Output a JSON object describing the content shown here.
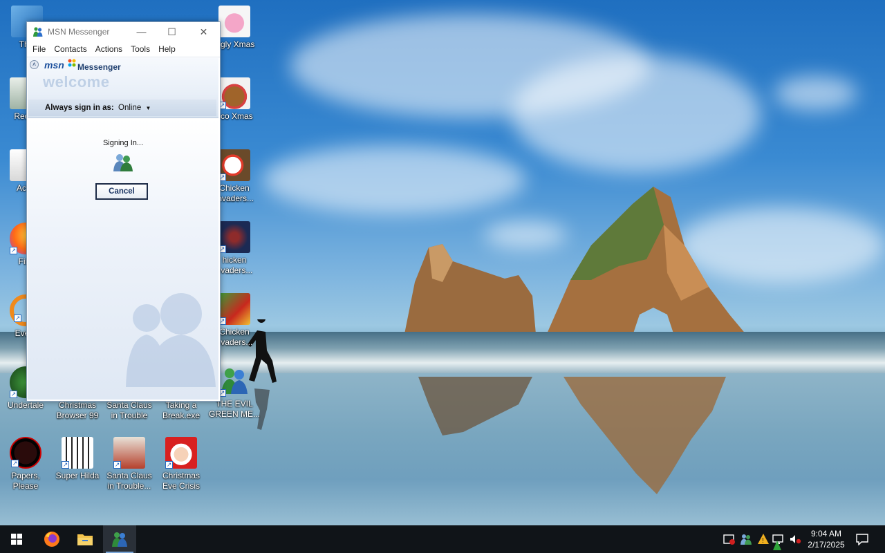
{
  "window": {
    "title": "MSN Messenger",
    "menu": [
      "File",
      "Contacts",
      "Actions",
      "Tools",
      "Help"
    ],
    "brand_logo": "msn",
    "brand_word": "Messenger",
    "welcome": "welcome",
    "status_label": "Always sign in as:",
    "status_value": "Online",
    "signing_text": "Signing In...",
    "cancel_label": "Cancel"
  },
  "desktop_icons": [
    {
      "label": "This",
      "icon": "computer-icon"
    },
    {
      "label": "Recyc",
      "icon": "recycle-bin-icon"
    },
    {
      "label": "Activ",
      "icon": "document-icon"
    },
    {
      "label": "Fire",
      "icon": "firefox-icon"
    },
    {
      "label": "Every",
      "icon": "search-icon"
    },
    {
      "label": "Undertale",
      "icon": "undertale-icon"
    },
    {
      "label": "Christmas Browser 99",
      "icon": "browser-icon"
    },
    {
      "label": "Santa Claus in Trouble",
      "icon": "santa-game-icon"
    },
    {
      "label": "Taking a Break.exe",
      "icon": "game-icon"
    },
    {
      "label": "THE EVIL GREEN ME...",
      "icon": "msn-icon"
    },
    {
      "label": "Papers, Please",
      "icon": "papers-please-icon"
    },
    {
      "label": "Super Hilda",
      "icon": "pixel-game-icon"
    },
    {
      "label": "Santa Claus in Trouble...",
      "icon": "santa-game-icon"
    },
    {
      "label": "Christmas Eve Crisis",
      "icon": "santa-icon"
    },
    {
      "label": "iggly Xmas",
      "icon": "pig-icon"
    },
    {
      "label": "oco Xmas",
      "icon": "bear-icon"
    },
    {
      "label": "Chicken Invaders...",
      "icon": "chicken-icon"
    },
    {
      "label": "hicken nvaders...",
      "icon": "chicken-icon"
    },
    {
      "label": "Chicken nvaders...",
      "icon": "chicken-icon"
    }
  ],
  "taskbar": {
    "time": "9:04 AM",
    "date": "2/17/2025"
  },
  "colors": {
    "taskbar": "#101418",
    "msn_blue": "#1b4f9c",
    "banner": "#e8eff8"
  }
}
